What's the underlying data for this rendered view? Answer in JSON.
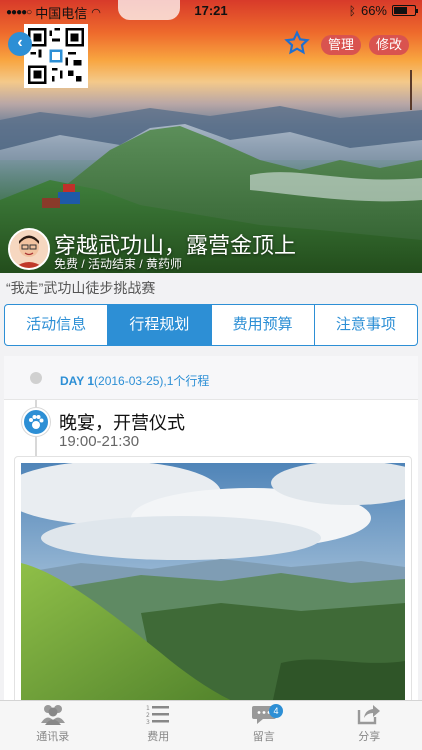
{
  "status_bar": {
    "carrier": "中国电信",
    "time": "17:21",
    "battery": "66%",
    "battery_level": 0.66
  },
  "header": {
    "manage_label": "管理",
    "edit_label": "修改"
  },
  "event": {
    "title": "穿越武功山，露营金顶上",
    "meta": "免费 / 活动结束 / 黄药师",
    "subtitle": "“我走”武功山徒步挑战赛"
  },
  "tabs": [
    {
      "label": "活动信息",
      "active": false
    },
    {
      "label": "行程规划",
      "active": true
    },
    {
      "label": "费用预算",
      "active": false
    },
    {
      "label": "注意事项",
      "active": false
    }
  ],
  "itinerary": {
    "day_label": "DAY 1",
    "day_detail": "(2016-03-25),1个行程",
    "items": [
      {
        "title": "晚宴，开营仪式",
        "time": "19:00-21:30"
      }
    ]
  },
  "bottom_bar": {
    "contacts": "通讯录",
    "expenses": "费用",
    "messages": "留言",
    "messages_badge": "4",
    "share": "分享"
  },
  "colors": {
    "accent": "#2d8fd5",
    "danger": "#d9534f"
  }
}
